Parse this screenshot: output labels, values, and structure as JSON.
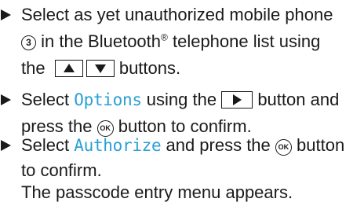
{
  "steps": [
    {
      "lines": [
        {
          "pre": "Select as yet unauthorized mobile phone"
        },
        {
          "circle": "3",
          "post": " in the Bluetooth",
          "reg": "®",
          "post2": " telephone list using"
        },
        {
          "pre": "the",
          "post": " buttons."
        }
      ]
    },
    {
      "lines": [
        {
          "pre": "Select ",
          "hl": "Options",
          "post": " using the",
          "post2": " button and"
        },
        {
          "pre": "press the ",
          "ok": "OK",
          "post": " button to confirm."
        }
      ]
    },
    {
      "lines": [
        {
          "pre": "Select ",
          "hl": "Authorize",
          "post": " and press the ",
          "ok": "OK",
          "post2": " button"
        },
        {
          "pre": "to confirm."
        },
        {
          "pre": "The passcode entry menu appears."
        }
      ]
    }
  ],
  "icons": {
    "bullet": "triangle-right-icon",
    "up_button": "up-arrow-icon",
    "down_button": "down-arrow-icon",
    "right_button": "right-arrow-icon",
    "ok_button": "ok-icon",
    "callout": "callout-number-icon"
  },
  "colors": {
    "highlight": "#2a9fd6",
    "text": "#1a1a1a"
  }
}
